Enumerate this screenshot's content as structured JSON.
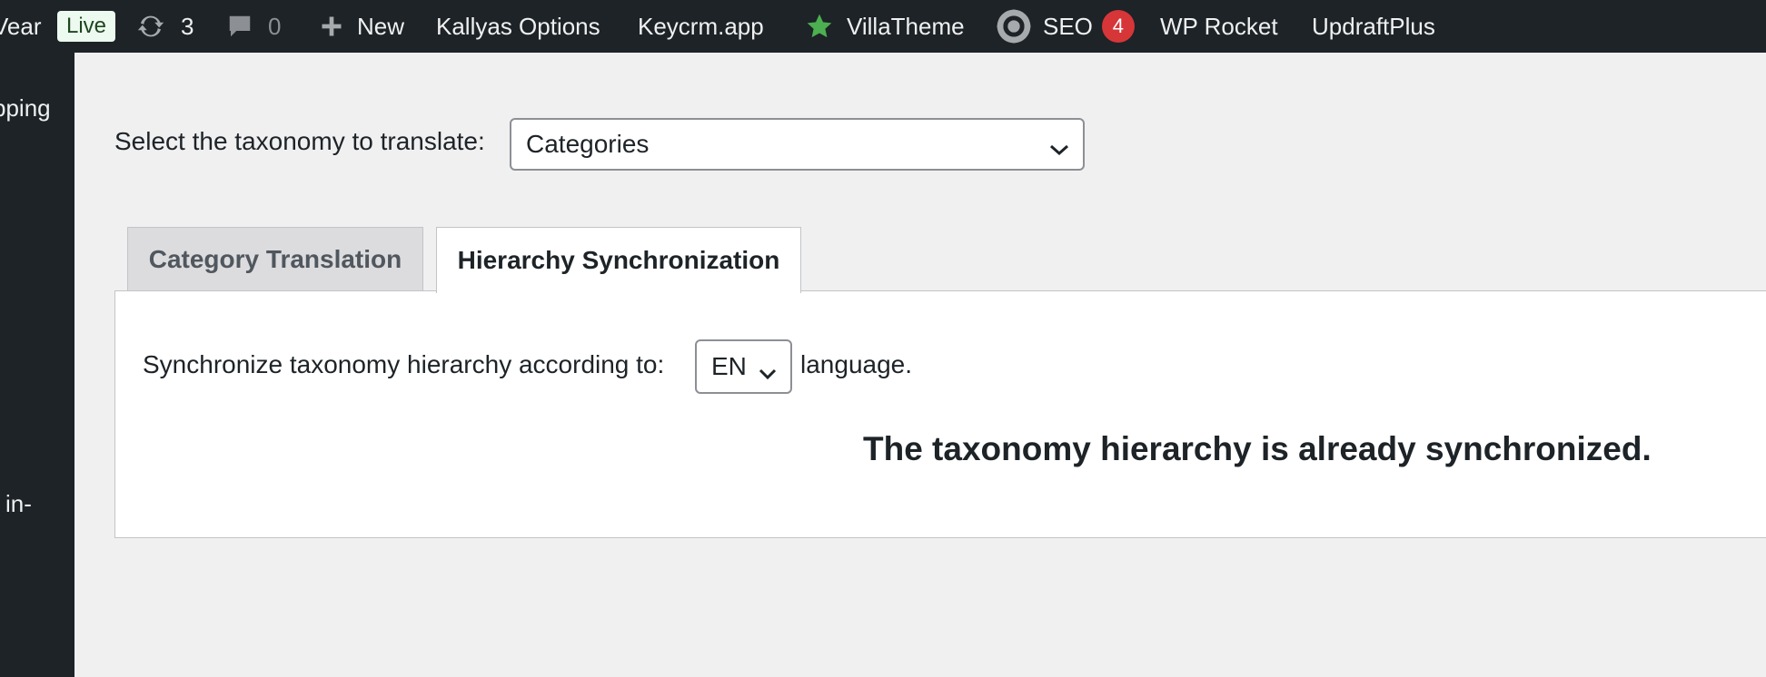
{
  "admin_bar": {
    "site_name_fragment": "Vear",
    "live_badge": "Live",
    "updates_icon": "refresh-icon",
    "updates_count": "3",
    "comments_icon": "comment-icon",
    "comments_count": "0",
    "new_icon": "plus-icon",
    "new_label": "New",
    "kallyas_label": "Kallyas Options",
    "keycrm_label": "Keycrm.app",
    "villatheme_icon": "star-icon",
    "villatheme_label": "VillaTheme",
    "seo_icon": "seo-gear-icon",
    "seo_label": "SEO",
    "seo_count": "4",
    "wprocket_label": "WP Rocket",
    "updraft_label": "UpdraftPlus",
    "colors": {
      "bar_bg": "#1d2327",
      "star": "#4caf50",
      "badge": "#d63638"
    }
  },
  "sidebar": {
    "items": [
      {
        "label": "pping"
      },
      {
        "label": "in-"
      }
    ]
  },
  "taxonomy": {
    "label": "Select the taxonomy to translate:",
    "selected": "Categories"
  },
  "tabs": [
    {
      "label": "Category Translation",
      "active": false
    },
    {
      "label": "Hierarchy Synchronization",
      "active": true
    }
  ],
  "sync": {
    "label": "Synchronize taxonomy hierarchy according to:",
    "language": "EN",
    "suffix": "language.",
    "status": "The taxonomy hierarchy is already synchronized."
  }
}
